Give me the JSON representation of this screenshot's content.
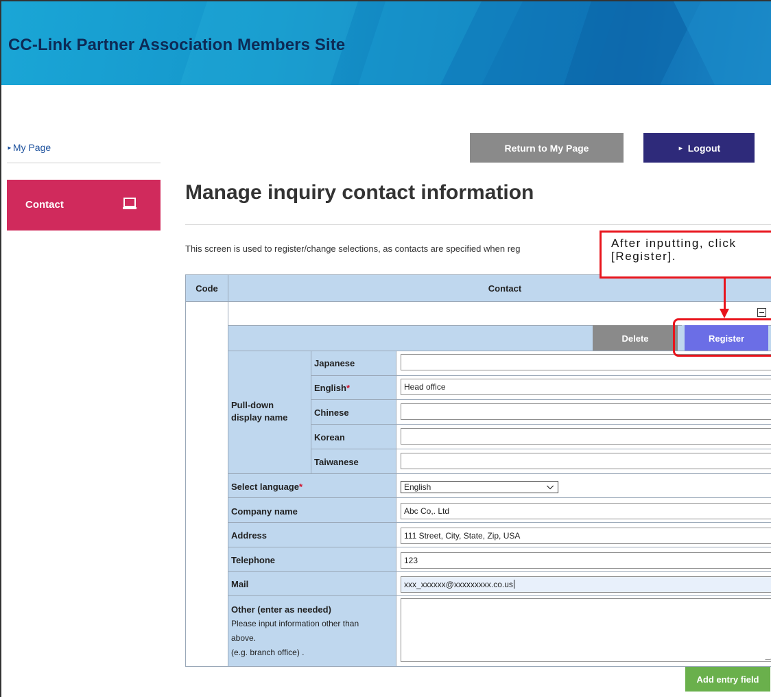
{
  "header": {
    "title": "CC-Link Partner Association Members Site"
  },
  "sidebar": {
    "mypage_link": "My Page",
    "contact_label": "Contact",
    "contact_icon": "laptop-icon"
  },
  "top_buttons": {
    "return_label": "Return to My Page",
    "logout_label": "Logout"
  },
  "main": {
    "title": "Manage inquiry contact information",
    "description": "This screen is used to register/change selections, as contacts are specified when reg"
  },
  "annotation": {
    "line1": "After inputting, click",
    "line2": "[Register]."
  },
  "table": {
    "code_header": "Code",
    "contact_header": "Contact",
    "delete_label": "Delete",
    "register_label": "Register",
    "pulldown_label_line1": "Pull-down",
    "pulldown_label_line2": "display name",
    "languages": {
      "japanese": "Japanese",
      "english": "English",
      "chinese": "Chinese",
      "korean": "Korean",
      "taiwanese": "Taiwanese"
    },
    "required_mark": "*",
    "values": {
      "japanese": "",
      "english": "Head office",
      "chinese": "",
      "korean": "",
      "taiwanese": ""
    },
    "select_language_label": "Select language",
    "select_language_value": "English",
    "company_label": "Company name",
    "company_value": "Abc Co,. Ltd",
    "address_label": "Address",
    "address_value": "111 Street, City, State, Zip, USA",
    "telephone_label": "Telephone",
    "telephone_value": "123",
    "mail_label": "Mail",
    "mail_value": "xxx_xxxxxx@xxxxxxxxx.co.us",
    "other_label": "Other (enter as needed)",
    "other_help_1": "Please input information other than",
    "other_help_2": "above.",
    "other_help_3": "(e.g. branch office) .",
    "other_value": ""
  },
  "add_entry_label": "Add entry field",
  "colors": {
    "header_blue": "#1596cb",
    "contact_pink": "#d02a5c",
    "logout_navy": "#2e2a7a",
    "register_purple": "#6b6ee6",
    "add_green": "#6ab04c",
    "annotation_red": "#e8141c",
    "table_header_blue": "#bfd7ee"
  }
}
